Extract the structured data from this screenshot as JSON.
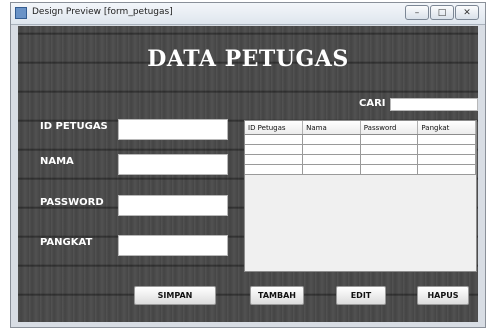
{
  "window": {
    "title": "Design Preview [form_petugas]",
    "controls": [
      "–",
      "□",
      "✕"
    ]
  },
  "form": {
    "heading": "DATA PETUGAS",
    "search_label": "CARI",
    "search_value": "",
    "fields": [
      {
        "label": "ID PETUGAS",
        "value": ""
      },
      {
        "label": "NAMA",
        "value": ""
      },
      {
        "label": "PASSWORD",
        "value": ""
      },
      {
        "label": "PANGKAT",
        "value": ""
      }
    ],
    "table": {
      "columns": [
        "ID Petugas",
        "Nama",
        "Password",
        "Pangkat"
      ],
      "rows": [
        [
          "",
          "",
          "",
          ""
        ],
        [
          "",
          "",
          "",
          ""
        ],
        [
          "",
          "",
          "",
          ""
        ],
        [
          "",
          "",
          "",
          ""
        ]
      ]
    },
    "buttons": {
      "simpan": "SIMPAN",
      "tambah": "TAMBAH",
      "edit": "EDIT",
      "hapus": "HAPUS"
    }
  }
}
